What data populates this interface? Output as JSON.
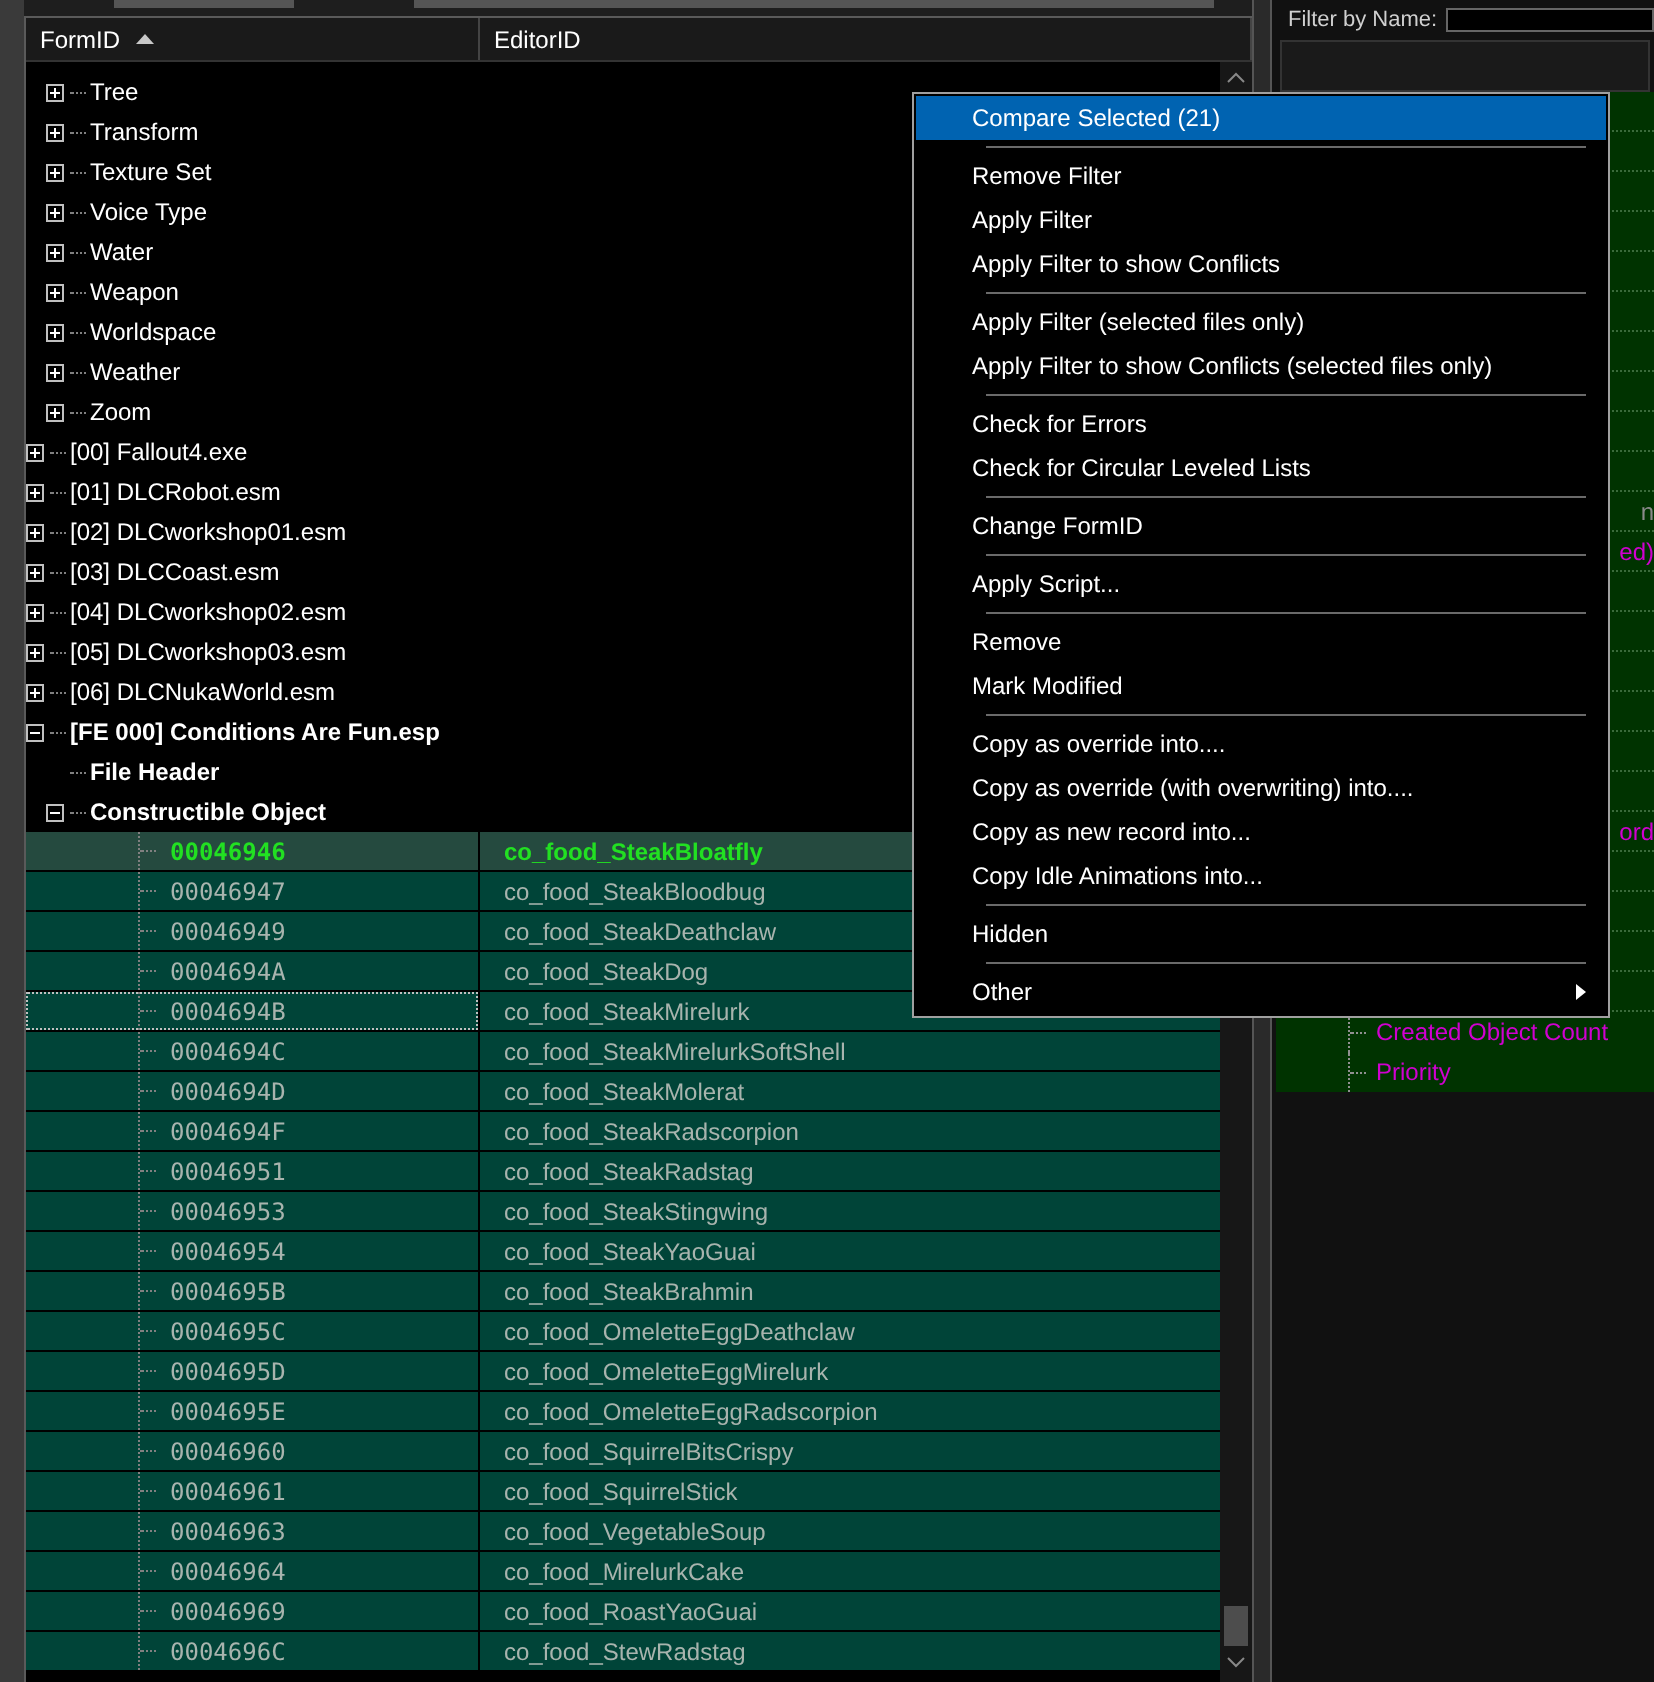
{
  "tree_view": {
    "columns": [
      {
        "label": "FormID",
        "sorted": true
      },
      {
        "label": "EditorID",
        "sorted": false
      }
    ],
    "nodes": [
      {
        "children": [
          {
            "label": "Tree",
            "expanded": false
          },
          {
            "label": "Transform",
            "expanded": false
          },
          {
            "label": "Texture Set",
            "expanded": false
          },
          {
            "label": "Voice Type",
            "expanded": false
          },
          {
            "label": "Water",
            "expanded": false
          },
          {
            "label": "Weapon",
            "expanded": false
          },
          {
            "label": "Worldspace",
            "expanded": false
          },
          {
            "label": "Weather",
            "expanded": false
          },
          {
            "label": "Zoom",
            "expanded": false
          }
        ]
      },
      {
        "label": "[00] Fallout4.exe",
        "expanded": false
      },
      {
        "label": "[01] DLCRobot.esm",
        "expanded": false
      },
      {
        "label": "[02] DLCworkshop01.esm",
        "expanded": false
      },
      {
        "label": "[03] DLCCoast.esm",
        "expanded": false
      },
      {
        "label": "[04] DLCworkshop02.esm",
        "expanded": false
      },
      {
        "label": "[05] DLCworkshop03.esm",
        "expanded": false
      },
      {
        "label": "[06] DLCNukaWorld.esm",
        "expanded": false
      },
      {
        "label": "[FE 000] Conditions Are Fun.esp",
        "expanded": true,
        "bold": true,
        "children": [
          {
            "label": "File Header",
            "bold": true
          },
          {
            "label": "Constructible Object",
            "bold": true,
            "expanded": true
          }
        ]
      }
    ],
    "records": [
      {
        "formid": "00046946",
        "editorid": "co_food_SteakBloatfly",
        "selected": true,
        "current": true,
        "focused": false
      },
      {
        "formid": "00046947",
        "editorid": "co_food_SteakBloodbug",
        "selected": true,
        "current": false,
        "focused": false
      },
      {
        "formid": "00046949",
        "editorid": "co_food_SteakDeathclaw",
        "selected": true,
        "current": false,
        "focused": false
      },
      {
        "formid": "0004694A",
        "editorid": "co_food_SteakDog",
        "selected": true,
        "current": false,
        "focused": false
      },
      {
        "formid": "0004694B",
        "editorid": "co_food_SteakMirelurk",
        "selected": true,
        "current": false,
        "focused": true
      },
      {
        "formid": "0004694C",
        "editorid": "co_food_SteakMirelurkSoftShell",
        "selected": true,
        "current": false,
        "focused": false
      },
      {
        "formid": "0004694D",
        "editorid": "co_food_SteakMolerat",
        "selected": true,
        "current": false,
        "focused": false
      },
      {
        "formid": "0004694F",
        "editorid": "co_food_SteakRadscorpion",
        "selected": true,
        "current": false,
        "focused": false
      },
      {
        "formid": "00046951",
        "editorid": "co_food_SteakRadstag",
        "selected": true,
        "current": false,
        "focused": false
      },
      {
        "formid": "00046953",
        "editorid": "co_food_SteakStingwing",
        "selected": true,
        "current": false,
        "focused": false
      },
      {
        "formid": "00046954",
        "editorid": "co_food_SteakYaoGuai",
        "selected": true,
        "current": false,
        "focused": false
      },
      {
        "formid": "0004695B",
        "editorid": "co_food_SteakBrahmin",
        "selected": true,
        "current": false,
        "focused": false
      },
      {
        "formid": "0004695C",
        "editorid": "co_food_OmeletteEggDeathclaw",
        "selected": true,
        "current": false,
        "focused": false
      },
      {
        "formid": "0004695D",
        "editorid": "co_food_OmeletteEggMirelurk",
        "selected": true,
        "current": false,
        "focused": false
      },
      {
        "formid": "0004695E",
        "editorid": "co_food_OmeletteEggRadscorpion",
        "selected": true,
        "current": false,
        "focused": false
      },
      {
        "formid": "00046960",
        "editorid": "co_food_SquirrelBitsCrispy",
        "selected": true,
        "current": false,
        "focused": false
      },
      {
        "formid": "00046961",
        "editorid": "co_food_SquirrelStick",
        "selected": true,
        "current": false,
        "focused": false
      },
      {
        "formid": "00046963",
        "editorid": "co_food_VegetableSoup",
        "selected": true,
        "current": false,
        "focused": false
      },
      {
        "formid": "00046964",
        "editorid": "co_food_MirelurkCake",
        "selected": true,
        "current": false,
        "focused": false
      },
      {
        "formid": "00046969",
        "editorid": "co_food_RoastYaoGuai",
        "selected": true,
        "current": false,
        "focused": false
      },
      {
        "formid": "0004696C",
        "editorid": "co_food_StewRadstag",
        "selected": true,
        "current": false,
        "focused": false
      }
    ]
  },
  "filter": {
    "label": "Filter by Name:"
  },
  "record_view": {
    "rows": [
      {
        "kind": "blank"
      },
      {
        "kind": "blank"
      },
      {
        "kind": "blank"
      },
      {
        "kind": "blank"
      },
      {
        "kind": "blank"
      },
      {
        "kind": "blank"
      },
      {
        "kind": "blank"
      },
      {
        "kind": "blank"
      },
      {
        "kind": "blank"
      },
      {
        "kind": "blank"
      },
      {
        "kind": "fragment",
        "text": "n",
        "color": "#8a8a8a"
      },
      {
        "kind": "fragment",
        "text": "ed)",
        "color": "#d000d0"
      },
      {
        "kind": "blank"
      },
      {
        "kind": "blank"
      },
      {
        "kind": "blank"
      },
      {
        "kind": "blank"
      },
      {
        "kind": "blank"
      },
      {
        "kind": "blank"
      },
      {
        "kind": "fragment",
        "text": "ord",
        "color": "#d000d0"
      },
      {
        "kind": "blank"
      },
      {
        "kind": "blank"
      },
      {
        "kind": "blank"
      },
      {
        "kind": "blank"
      },
      {
        "kind": "field",
        "text": "Created Object Count",
        "color": "#d000d0"
      },
      {
        "kind": "field",
        "text": "Priority",
        "color": "#d000d0"
      }
    ]
  },
  "context_menu": {
    "items": [
      {
        "kind": "item",
        "label": "Compare Selected (21)",
        "selected": true
      },
      {
        "kind": "separator"
      },
      {
        "kind": "item",
        "label": "Remove Filter",
        "selected": false
      },
      {
        "kind": "item",
        "label": "Apply Filter",
        "selected": false
      },
      {
        "kind": "item",
        "label": "Apply Filter to show Conflicts",
        "selected": false
      },
      {
        "kind": "separator"
      },
      {
        "kind": "item",
        "label": "Apply Filter (selected files only)",
        "selected": false
      },
      {
        "kind": "item",
        "label": "Apply Filter to show Conflicts (selected files only)",
        "selected": false
      },
      {
        "kind": "separator"
      },
      {
        "kind": "item",
        "label": "Check for Errors",
        "selected": false
      },
      {
        "kind": "item",
        "label": "Check for Circular Leveled Lists",
        "selected": false
      },
      {
        "kind": "separator"
      },
      {
        "kind": "item",
        "label": "Change FormID",
        "selected": false
      },
      {
        "kind": "separator"
      },
      {
        "kind": "item",
        "label": "Apply Script...",
        "selected": false
      },
      {
        "kind": "separator"
      },
      {
        "kind": "item",
        "label": "Remove",
        "selected": false
      },
      {
        "kind": "item",
        "label": "Mark Modified",
        "selected": false
      },
      {
        "kind": "separator"
      },
      {
        "kind": "item",
        "label": "Copy as override into....",
        "selected": false
      },
      {
        "kind": "item",
        "label": "Copy as override (with overwriting) into....",
        "selected": false
      },
      {
        "kind": "item",
        "label": "Copy as new record into...",
        "selected": false
      },
      {
        "kind": "item",
        "label": "Copy Idle Animations into...",
        "selected": false
      },
      {
        "kind": "separator"
      },
      {
        "kind": "item",
        "label": "Hidden",
        "selected": false
      },
      {
        "kind": "separator"
      },
      {
        "kind": "submenu",
        "label": "Other",
        "selected": false
      }
    ]
  }
}
